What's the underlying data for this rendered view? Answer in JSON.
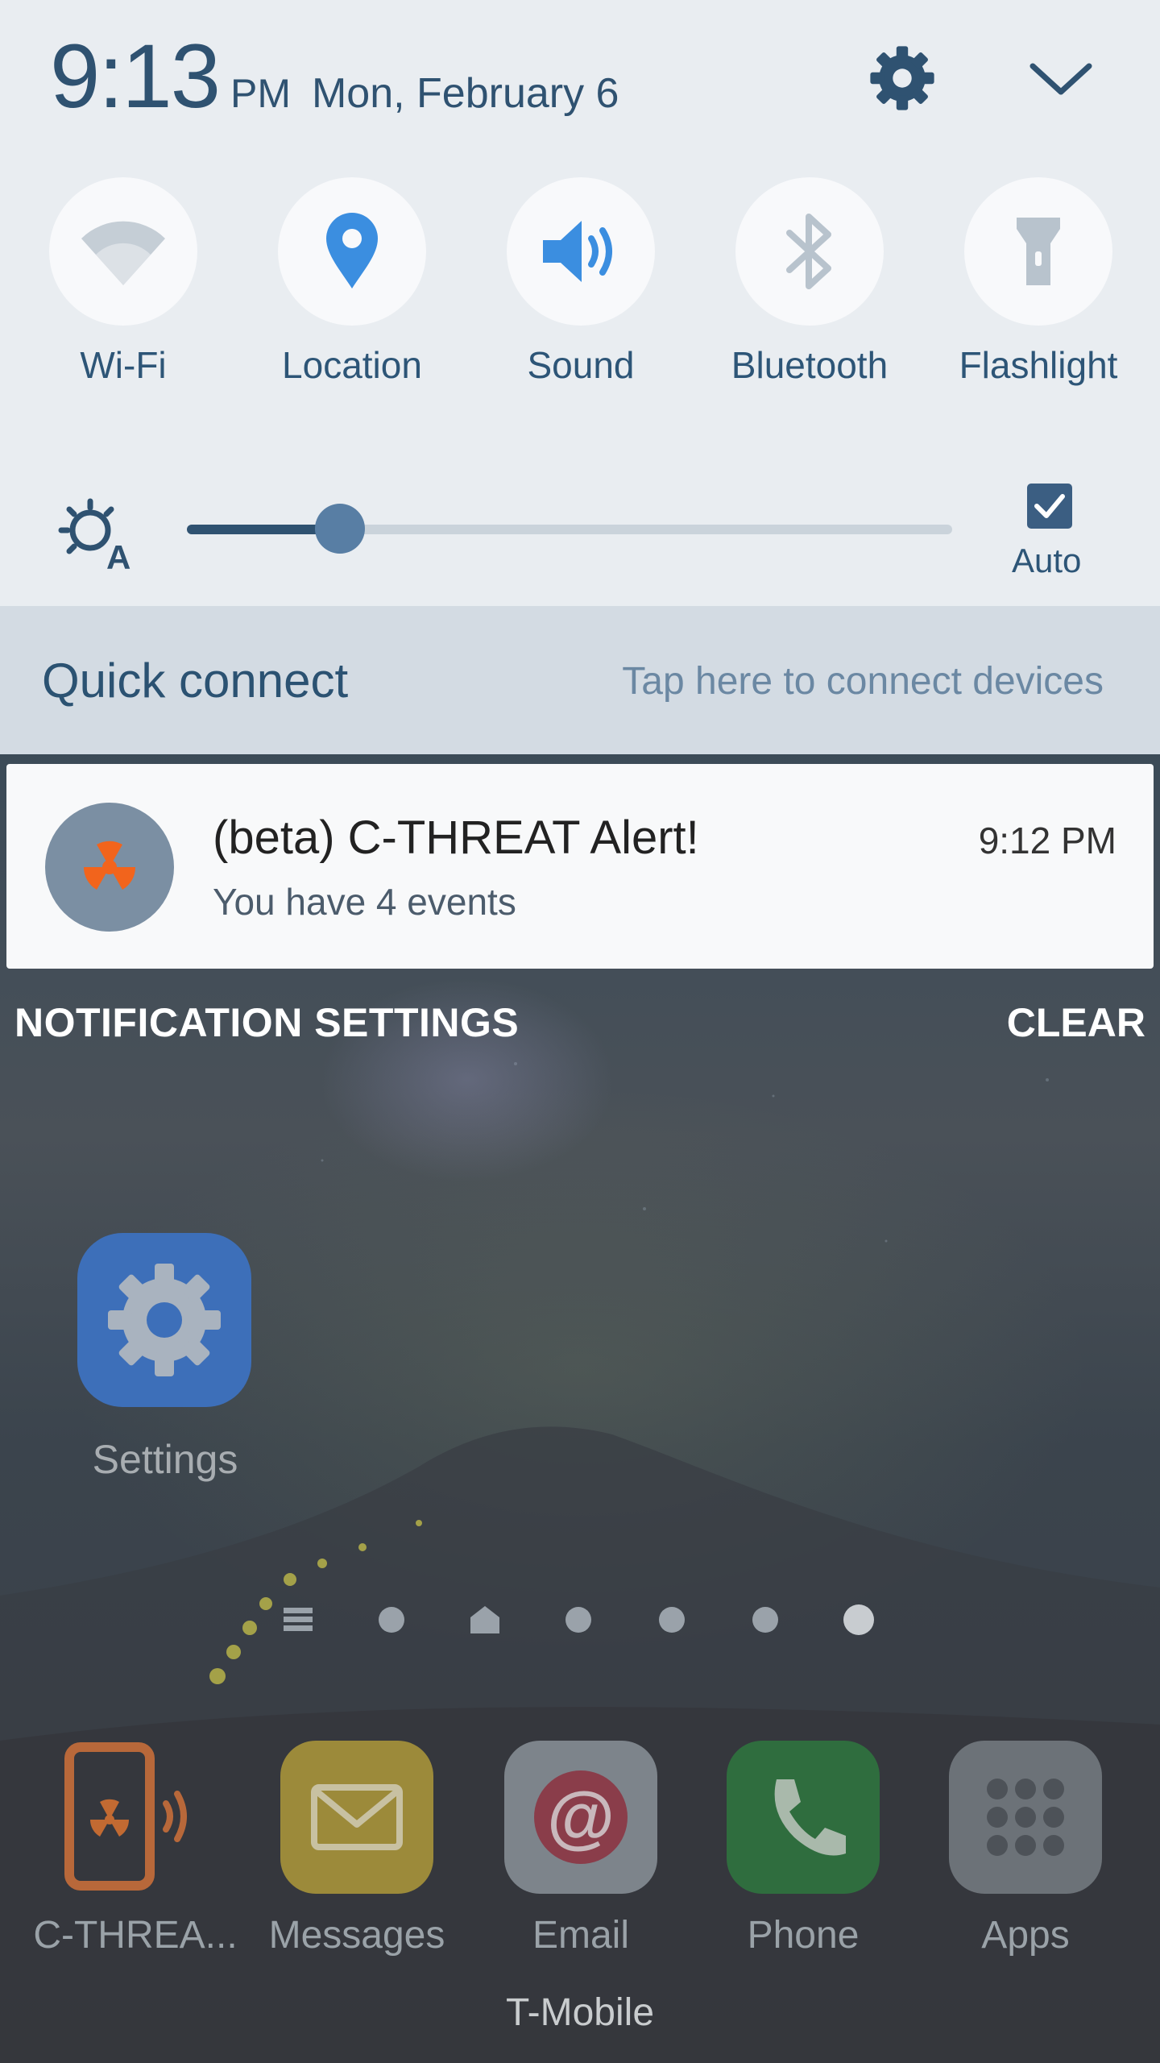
{
  "status": {
    "time": "9:13",
    "ampm": "PM",
    "date": "Mon, February 6"
  },
  "toggles": [
    {
      "label": "Wi-Fi",
      "icon": "wifi-icon",
      "active": false
    },
    {
      "label": "Location",
      "icon": "location-icon",
      "active": true
    },
    {
      "label": "Sound",
      "icon": "sound-icon",
      "active": true
    },
    {
      "label": "Bluetooth",
      "icon": "bluetooth-icon",
      "active": false
    },
    {
      "label": "Flashlight",
      "icon": "flashlight-icon",
      "active": false
    }
  ],
  "brightness": {
    "level": 0.2,
    "auto_label": "Auto",
    "auto_checked": true
  },
  "quick_connect": {
    "title": "Quick connect",
    "hint": "Tap here to connect devices"
  },
  "notification": {
    "title": "(beta) C-THREAT Alert!",
    "subtitle": "You have 4 events",
    "time": "9:12 PM",
    "icon": "radiation-icon"
  },
  "actions": {
    "settings_label": "NOTIFICATION SETTINGS",
    "clear_label": "CLEAR"
  },
  "home": {
    "app_label": "Settings",
    "pages": 7,
    "current_page": 7,
    "dock": [
      {
        "label": "C-THREA...",
        "icon": "c-threat-app-icon"
      },
      {
        "label": "Messages",
        "icon": "messages-icon"
      },
      {
        "label": "Email",
        "icon": "email-icon"
      },
      {
        "label": "Phone",
        "icon": "phone-icon"
      },
      {
        "label": "Apps",
        "icon": "apps-icon"
      }
    ],
    "carrier": "T-Mobile"
  },
  "colors": {
    "accent": "#2f5271",
    "active_icon": "#3b8ee0",
    "inactive_icon": "#b8c3cd",
    "radiation": "#f2641c"
  }
}
